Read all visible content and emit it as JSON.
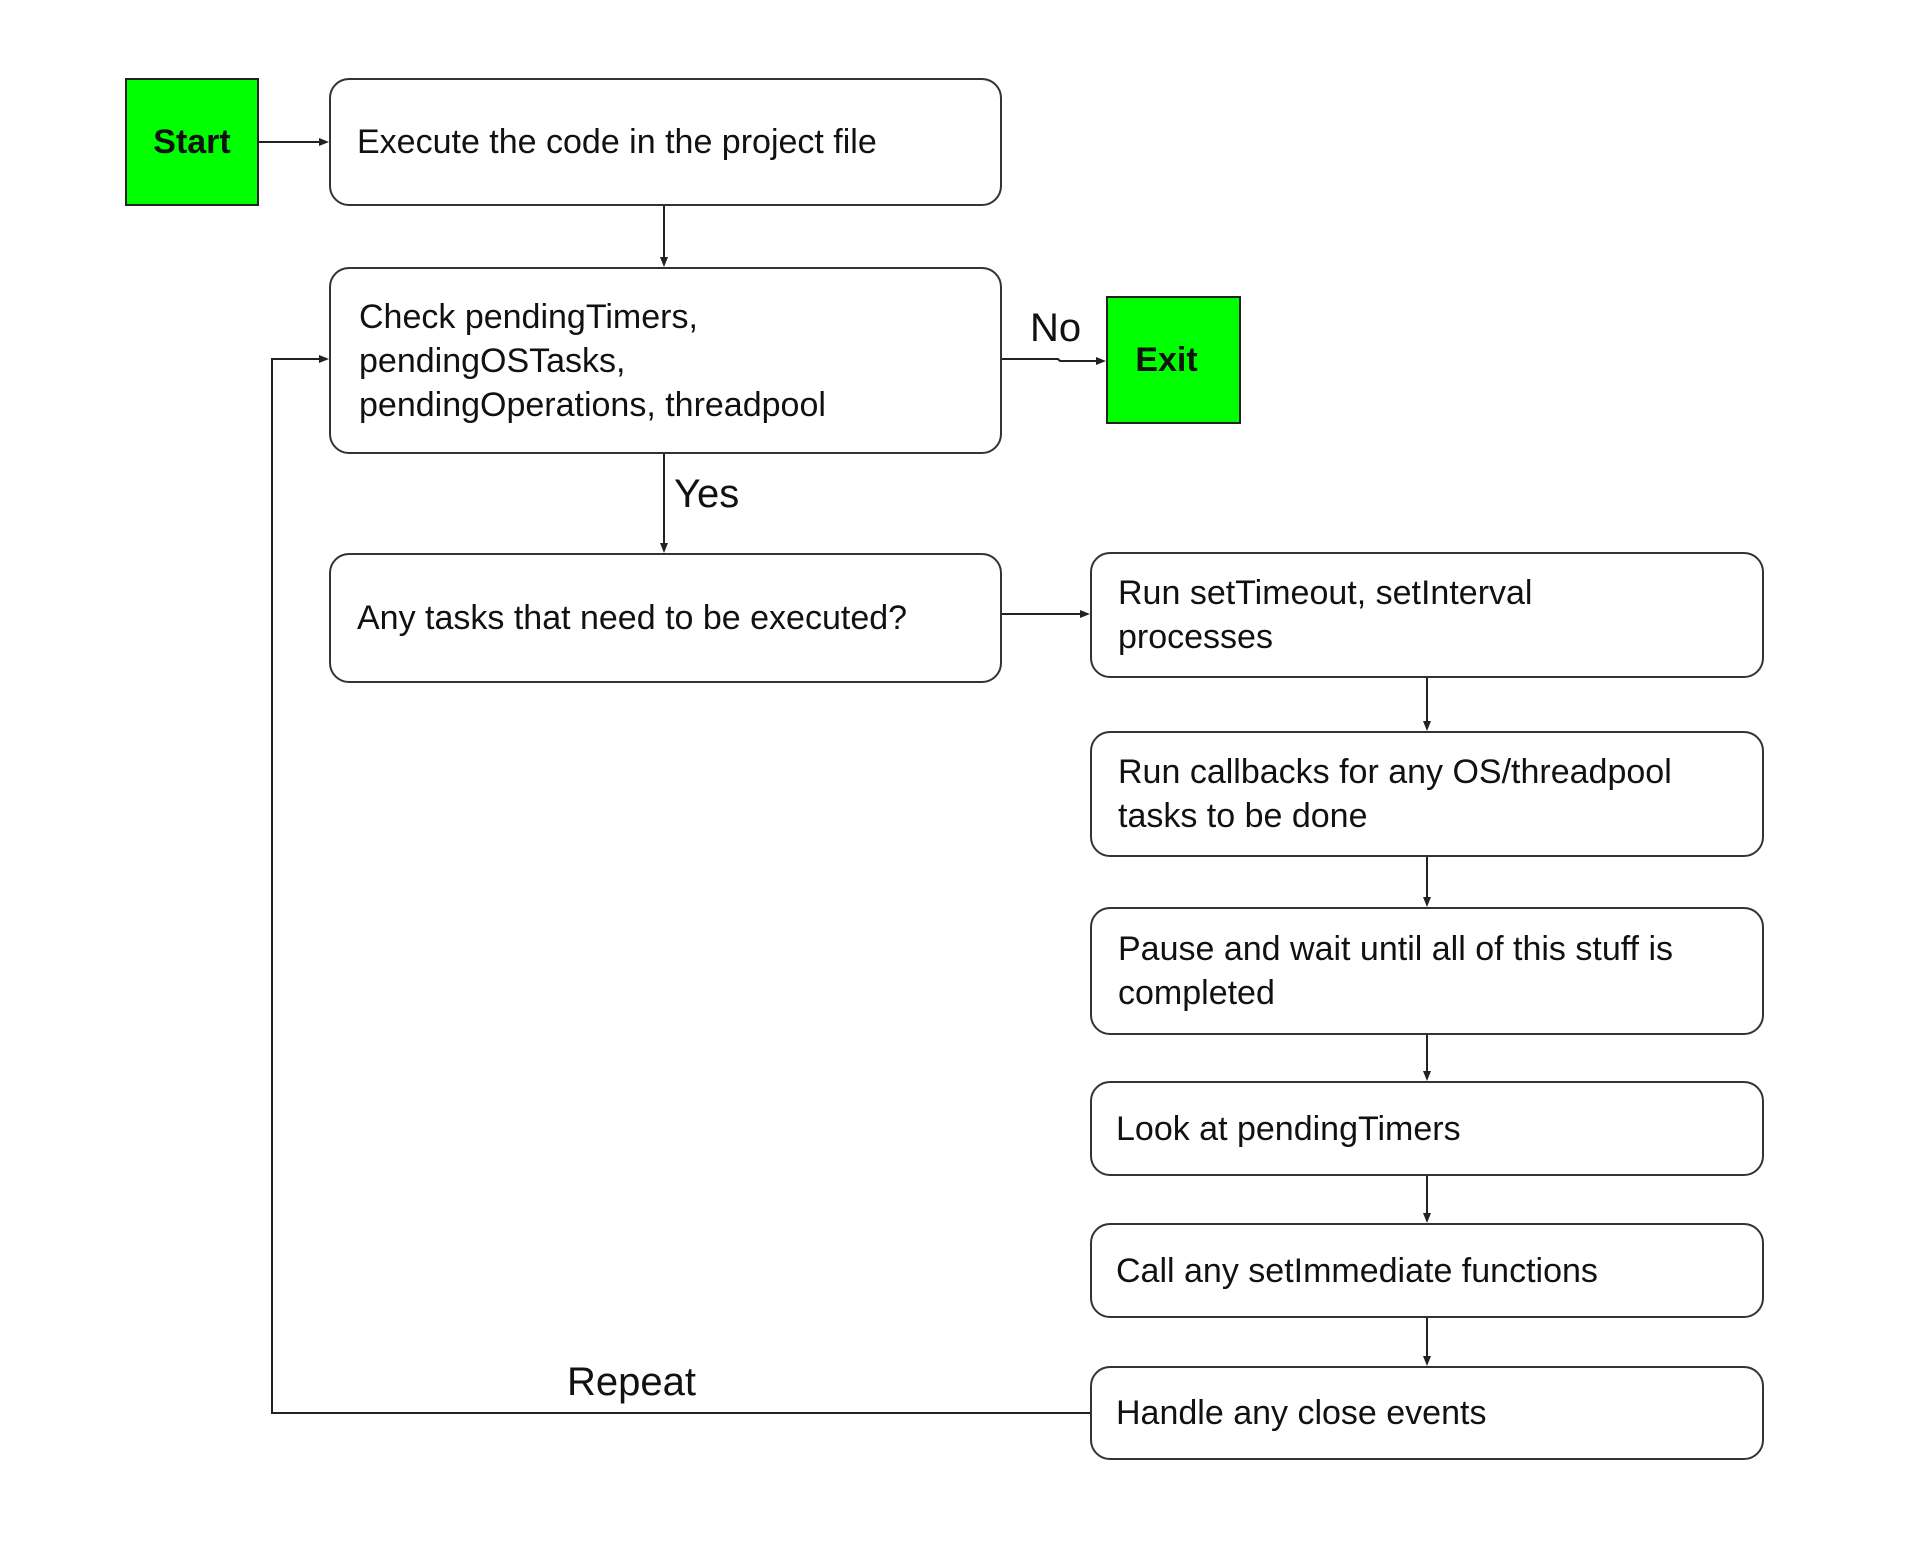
{
  "diagram": {
    "type": "flowchart",
    "colors": {
      "terminal_fill": "#00ff00",
      "process_fill": "#ffffff",
      "stroke": "#222222",
      "text": "#111111"
    },
    "nodes": {
      "start": {
        "label": "Start",
        "shape": "terminal"
      },
      "execute": {
        "label": "Execute the code in the project file",
        "shape": "process"
      },
      "check": {
        "label": "Check pendingTimers,\npendingOSTasks,\npendingOperations, threadpool",
        "shape": "process"
      },
      "exit": {
        "label": "Exit",
        "shape": "terminal"
      },
      "any_tasks": {
        "label": "Any tasks that need to be executed?",
        "shape": "process"
      },
      "run_timers": {
        "label": "Run setTimeout, setInterval\nprocesses",
        "shape": "process"
      },
      "run_callbacks": {
        "label": "Run callbacks for any OS/threadpool\ntasks to be done",
        "shape": "process"
      },
      "pause_wait": {
        "label": "Pause and wait until all of this stuff is\ncompleted",
        "shape": "process"
      },
      "look_timers": {
        "label": "Look at pendingTimers",
        "shape": "process"
      },
      "set_immediate": {
        "label": "Call any setImmediate functions",
        "shape": "process"
      },
      "close_events": {
        "label": "Handle any close events",
        "shape": "process"
      }
    },
    "edge_labels": {
      "no": "No",
      "yes": "Yes",
      "repeat": "Repeat"
    },
    "edges": [
      {
        "from": "start",
        "to": "execute",
        "label": ""
      },
      {
        "from": "execute",
        "to": "check",
        "label": ""
      },
      {
        "from": "check",
        "to": "exit",
        "label": "No"
      },
      {
        "from": "check",
        "to": "any_tasks",
        "label": "Yes"
      },
      {
        "from": "any_tasks",
        "to": "run_timers",
        "label": ""
      },
      {
        "from": "run_timers",
        "to": "run_callbacks",
        "label": ""
      },
      {
        "from": "run_callbacks",
        "to": "pause_wait",
        "label": ""
      },
      {
        "from": "pause_wait",
        "to": "look_timers",
        "label": ""
      },
      {
        "from": "look_timers",
        "to": "set_immediate",
        "label": ""
      },
      {
        "from": "set_immediate",
        "to": "close_events",
        "label": ""
      },
      {
        "from": "close_events",
        "to": "check",
        "label": "Repeat"
      }
    ]
  }
}
